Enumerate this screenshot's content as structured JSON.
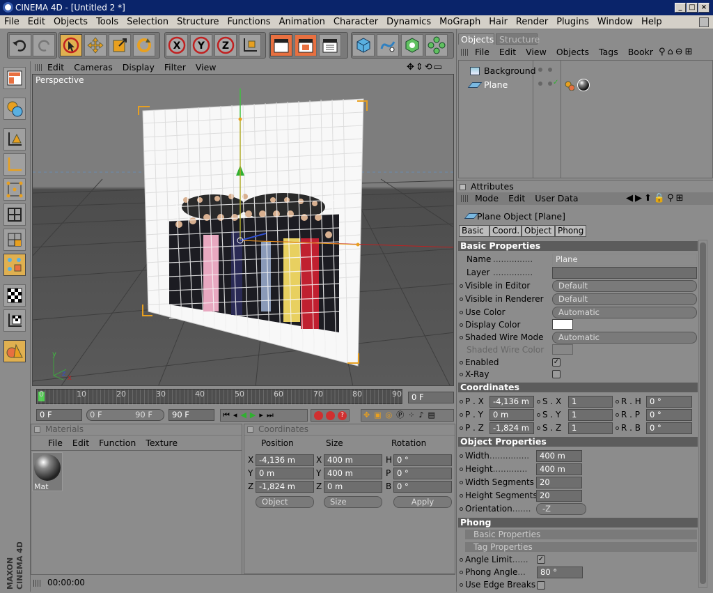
{
  "window": {
    "title": "CINEMA 4D - [Untitled 2 *]"
  },
  "menubar": [
    "File",
    "Edit",
    "Objects",
    "Tools",
    "Selection",
    "Structure",
    "Functions",
    "Animation",
    "Character",
    "Dynamics",
    "MoGraph",
    "Hair",
    "Render",
    "Plugins",
    "Window",
    "Help"
  ],
  "viewport": {
    "menu": [
      "Edit",
      "Cameras",
      "Display",
      "Filter",
      "View"
    ],
    "label": "Perspective"
  },
  "timeline": {
    "ticks": [
      "0",
      "10",
      "20",
      "30",
      "40",
      "50",
      "60",
      "70",
      "80",
      "90"
    ],
    "current_frame": "0 F",
    "start": "0 F",
    "range_start": "0 F",
    "range_end": "90 F",
    "end": "90 F"
  },
  "objects_panel": {
    "tabs": [
      "Objects",
      "Structure"
    ],
    "menu": [
      "File",
      "Edit",
      "View",
      "Objects",
      "Tags",
      "Bookr"
    ],
    "items": [
      {
        "name": "Background"
      },
      {
        "name": "Plane",
        "selected": true
      }
    ]
  },
  "attributes": {
    "header": "Attributes",
    "menu": [
      "Mode",
      "Edit",
      "User Data"
    ],
    "object_title": "Plane Object [Plane]",
    "tabs": [
      "Basic",
      "Coord.",
      "Object",
      "Phong"
    ],
    "basic": {
      "title": "Basic Properties",
      "rows": [
        {
          "label": "Name",
          "value": "Plane"
        },
        {
          "label": "Layer",
          "value": ""
        },
        {
          "label": "Visible in Editor",
          "value": "Default"
        },
        {
          "label": "Visible in Renderer",
          "value": "Default"
        },
        {
          "label": "Use Color",
          "value": "Automatic"
        },
        {
          "label": "Display Color",
          "value": ""
        },
        {
          "label": "Shaded Wire Mode",
          "value": "Automatic"
        },
        {
          "label": "Shaded Wire Color",
          "value": ""
        },
        {
          "label": "Enabled",
          "value": "✓"
        },
        {
          "label": "X-Ray",
          "value": ""
        }
      ]
    },
    "coords": {
      "title": "Coordinates",
      "rows": [
        [
          "P . X",
          "-4,136 m",
          "S . X",
          "1",
          "R . H",
          "0 °"
        ],
        [
          "P . Y",
          "0 m",
          "S . Y",
          "1",
          "R . P",
          "0 °"
        ],
        [
          "P . Z",
          "-1,824 m",
          "S . Z",
          "1",
          "R . B",
          "0 °"
        ]
      ]
    },
    "object": {
      "title": "Object Properties",
      "rows": [
        {
          "label": "Width",
          "value": "400 m"
        },
        {
          "label": "Height",
          "value": "400 m"
        },
        {
          "label": "Width Segments",
          "value": "20"
        },
        {
          "label": "Height Segments",
          "value": "20"
        },
        {
          "label": "Orientation",
          "value": "-Z"
        }
      ]
    },
    "phong": {
      "title": "Phong",
      "sub1": "Basic Properties",
      "sub2": "Tag Properties",
      "rows": [
        {
          "label": "Angle Limit",
          "value": "✓"
        },
        {
          "label": "Phong Angle",
          "value": "80 °"
        },
        {
          "label": "Use Edge Breaks",
          "value": ""
        }
      ]
    }
  },
  "materials": {
    "header": "Materials",
    "menu": [
      "File",
      "Edit",
      "Function",
      "Texture"
    ],
    "items": [
      "Mat"
    ]
  },
  "coordinates_panel": {
    "header": "Coordinates",
    "cols": [
      "Position",
      "Size",
      "Rotation"
    ],
    "rows": [
      [
        "X",
        "-4,136 m",
        "X",
        "400 m",
        "H",
        "0 °"
      ],
      [
        "Y",
        "0 m",
        "Y",
        "400 m",
        "P",
        "0 °"
      ],
      [
        "Z",
        "-1,824 m",
        "Z",
        "0 m",
        "B",
        "0 °"
      ]
    ],
    "modes": [
      "Object",
      "Size"
    ],
    "apply": "Apply"
  },
  "status": {
    "time": "00:00:00"
  },
  "brand": "MAXON CINEMA 4D",
  "colors": {
    "accent": "#e0b050",
    "selection": "#3a6ea5",
    "panel": "#8c8c8c"
  }
}
